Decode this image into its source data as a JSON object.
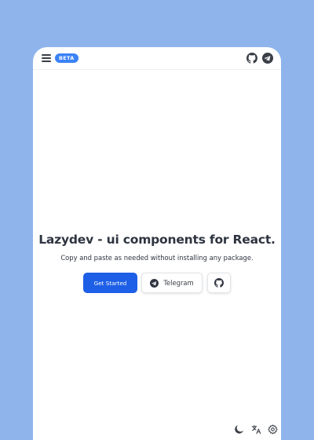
{
  "header": {
    "badge": "BETA",
    "icons": [
      "menu-icon",
      "github-icon",
      "telegram-icon"
    ]
  },
  "hero": {
    "title": "Lazydev - ui components for React.",
    "subtitle": "Copy and paste as needed without installing any package."
  },
  "actions": {
    "get_started": "Get Started",
    "telegram": "Telegram"
  },
  "footer_icons": [
    "moon-icon",
    "translate-icon",
    "settings-icon"
  ],
  "colors": {
    "background": "#8fb4ec",
    "primary": "#1d5fe6",
    "badge": "#3b82f6",
    "text": "#2e3440"
  }
}
